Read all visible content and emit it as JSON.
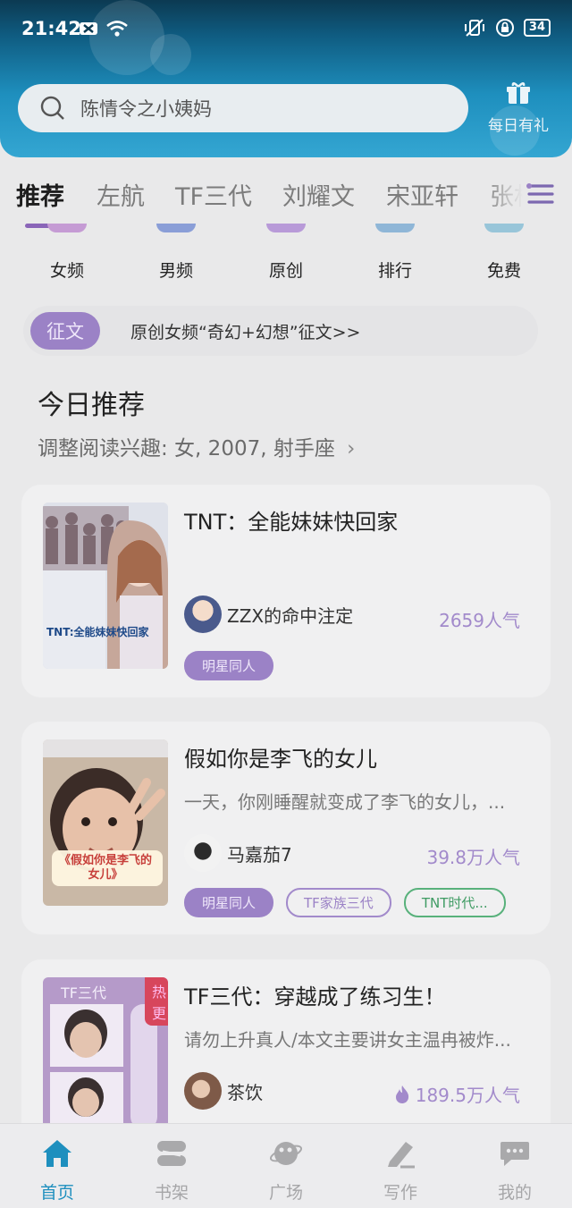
{
  "status_bar": {
    "time": "21:42",
    "battery": "34"
  },
  "search": {
    "placeholder": "陈情令之小姨妈"
  },
  "gift": {
    "label": "每日有礼"
  },
  "tabs": [
    {
      "label": "推荐"
    },
    {
      "label": "左航"
    },
    {
      "label": "TF三代"
    },
    {
      "label": "刘耀文"
    },
    {
      "label": "宋亚轩"
    },
    {
      "label": "张机"
    }
  ],
  "categories": [
    {
      "label": "女频",
      "color": "#c59bd4"
    },
    {
      "label": "男频",
      "color": "#8a9ed7"
    },
    {
      "label": "原创",
      "color": "#b89ad8"
    },
    {
      "label": "排行",
      "color": "#8fb6d7"
    },
    {
      "label": "免费",
      "color": "#98c5d9"
    }
  ],
  "notice": {
    "badge": "征文",
    "text": "原创女频“奇幻+幻想”征文>>"
  },
  "section": {
    "title": "今日推荐",
    "subtitle": "调整阅读兴趣: 女, 2007, 射手座"
  },
  "books": [
    {
      "title": "TNT：全能妹妹快回家",
      "cover_text": "TNT:全能妹妹快回家",
      "author": "ZZX的命中注定",
      "popularity": "2659人气",
      "tags": [
        "明星同人"
      ]
    },
    {
      "title": "假如你是李飞的女儿",
      "description": "一天，你刚睡醒就变成了李飞的女儿，...",
      "cover_text": "《假如你是李飞的女儿》",
      "author": "马嘉茄7",
      "popularity": "39.8万人气",
      "tags": [
        "明星同人",
        "TF家族三代",
        "TNT时代..."
      ]
    },
    {
      "title": "TF三代：穿越成了练习生！",
      "description": "请勿上升真人/本文主要讲女主温冉被炸...",
      "cover_text": "TF三代",
      "hot_badge": "热更",
      "author": "茶饮",
      "popularity": "189.5万人气"
    }
  ],
  "bottom_nav": [
    {
      "label": "首页",
      "icon": "home-icon"
    },
    {
      "label": "书架",
      "icon": "bookshelf-icon"
    },
    {
      "label": "广场",
      "icon": "planet-icon"
    },
    {
      "label": "写作",
      "icon": "pen-icon"
    },
    {
      "label": "我的",
      "icon": "chat-icon"
    }
  ],
  "colors": {
    "accent": "#9b82c6",
    "nav_active": "#1e8fbe",
    "header": "#1e8fbe"
  }
}
